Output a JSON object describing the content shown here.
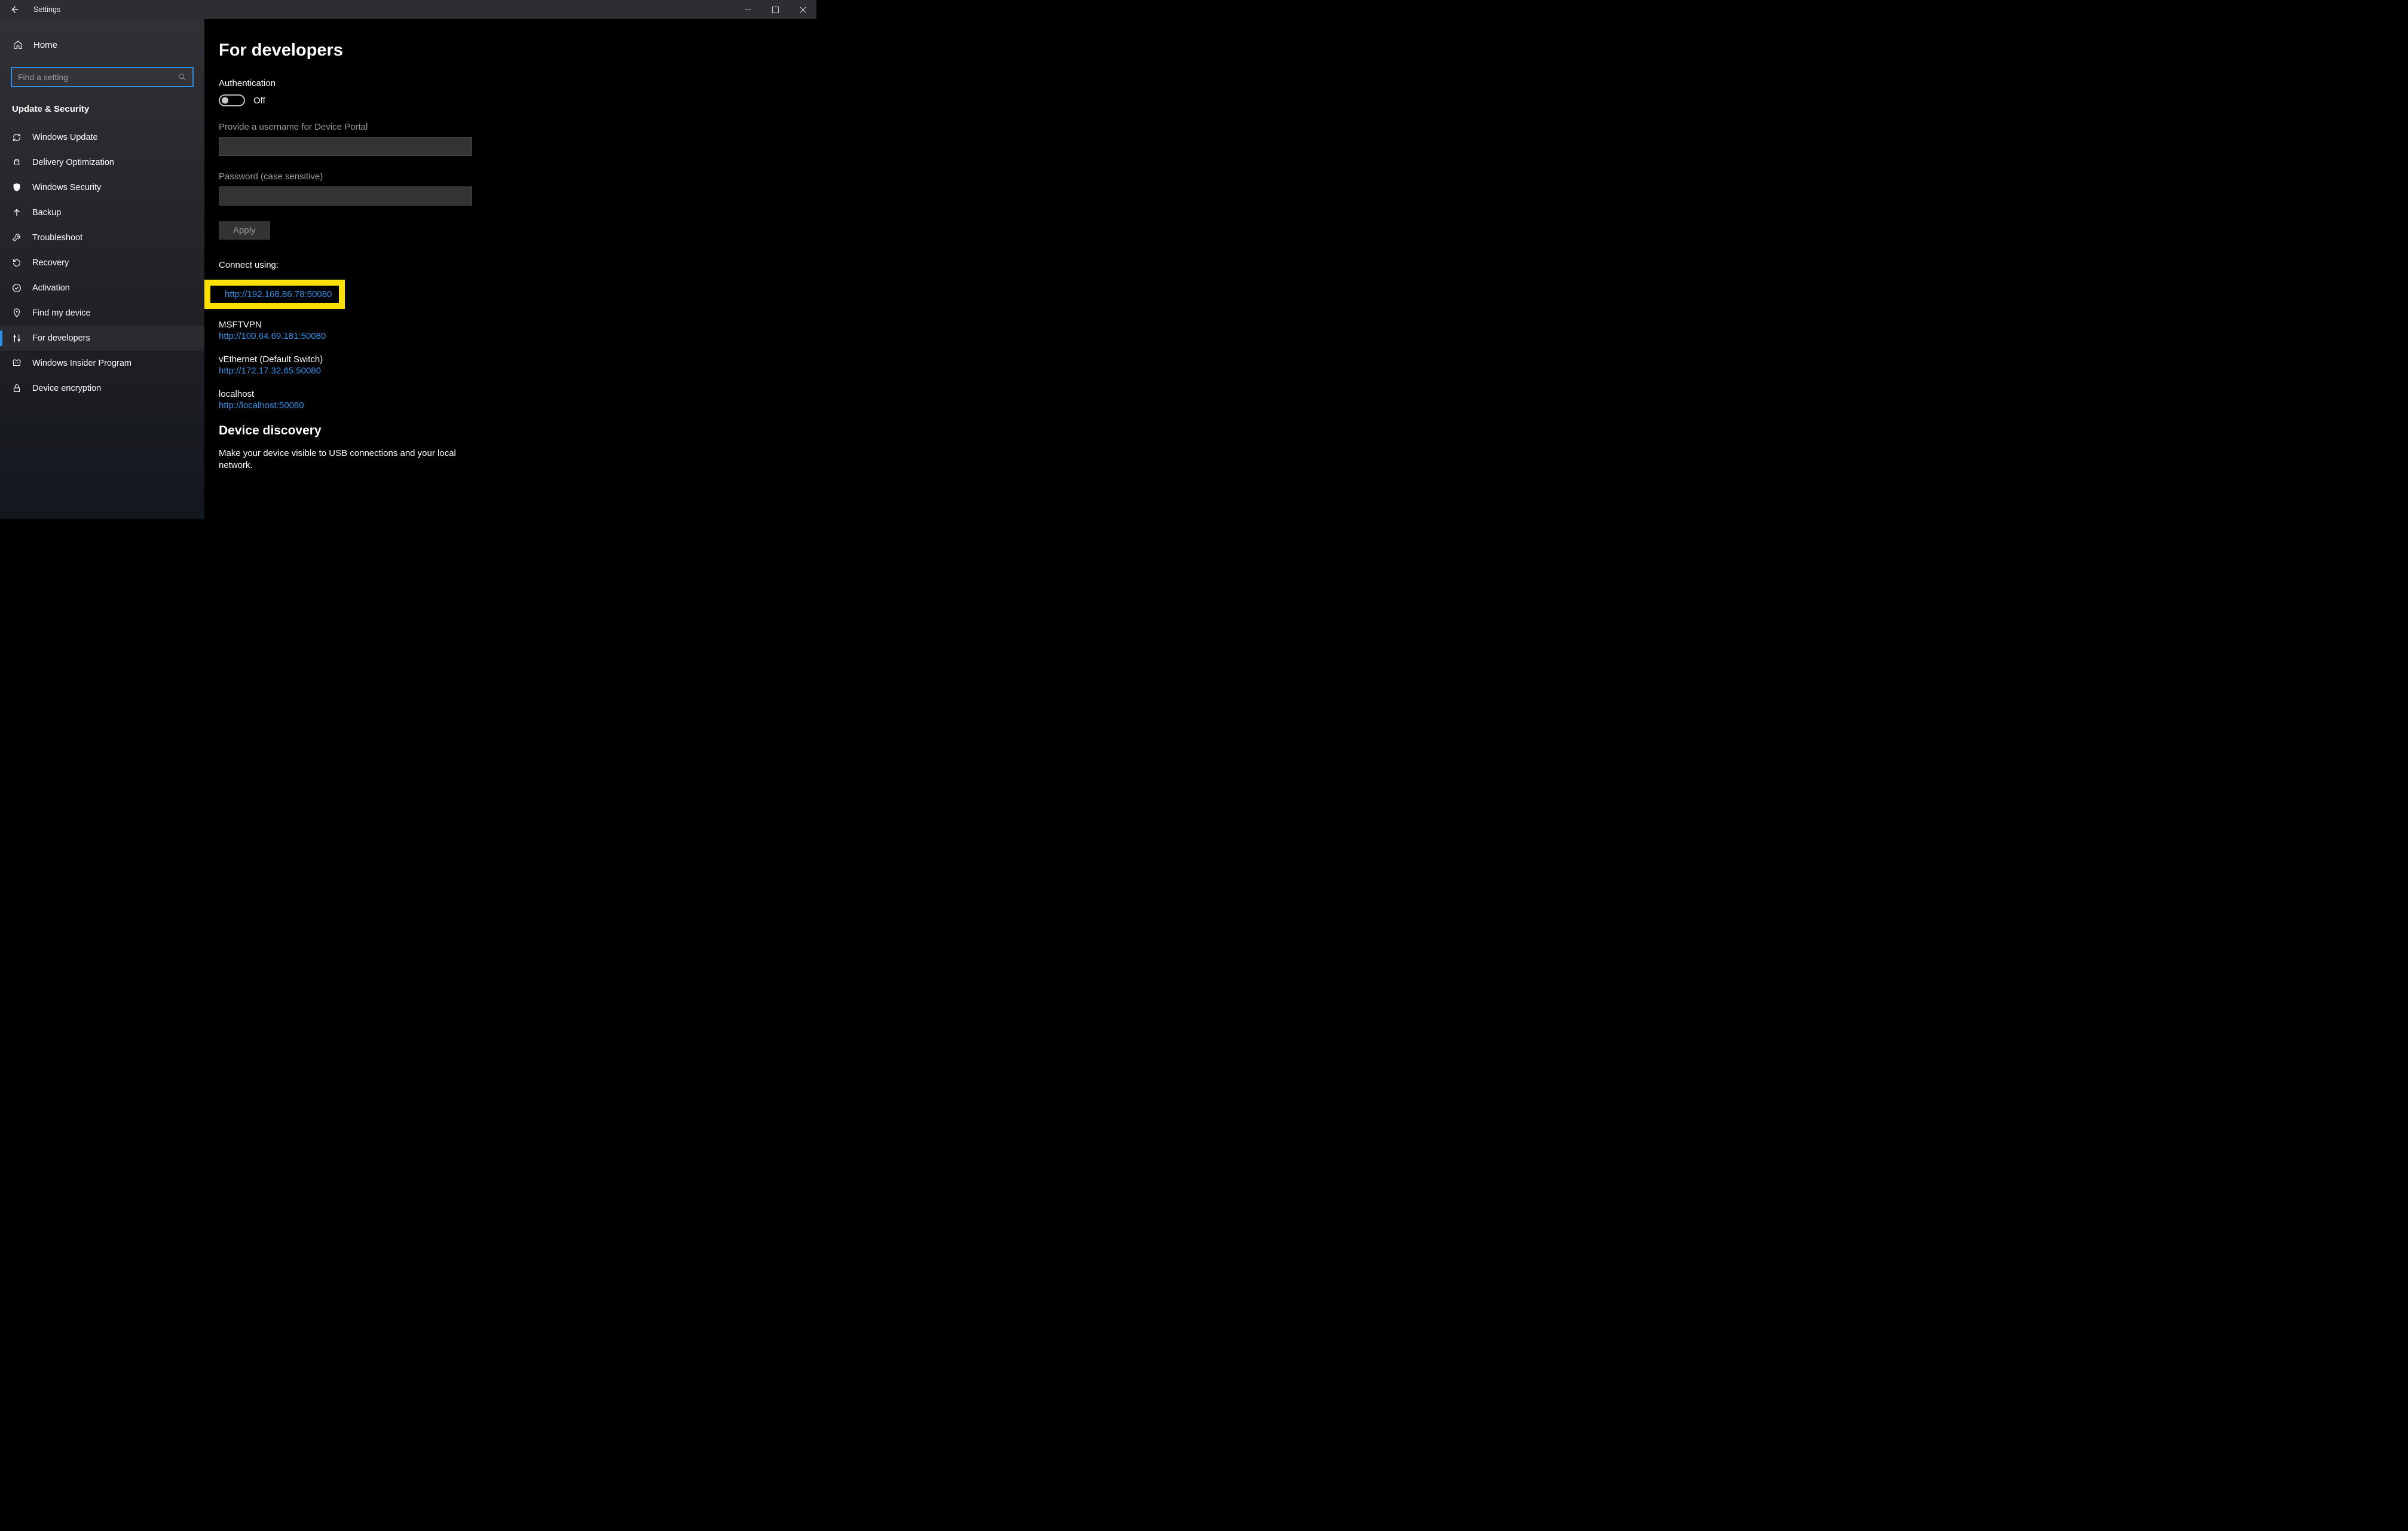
{
  "window": {
    "title": "Settings"
  },
  "sidebar": {
    "home_label": "Home",
    "search_placeholder": "Find a setting",
    "category_label": "Update & Security",
    "items": [
      {
        "label": "Windows Update"
      },
      {
        "label": "Delivery Optimization"
      },
      {
        "label": "Windows Security"
      },
      {
        "label": "Backup"
      },
      {
        "label": "Troubleshoot"
      },
      {
        "label": "Recovery"
      },
      {
        "label": "Activation"
      },
      {
        "label": "Find my device"
      },
      {
        "label": "For developers"
      },
      {
        "label": "Windows Insider Program"
      },
      {
        "label": "Device encryption"
      }
    ]
  },
  "main": {
    "page_title": "For developers",
    "auth": {
      "heading": "Authentication",
      "toggle_state_label": "Off",
      "username_label": "Provide a username for Device Portal",
      "password_label": "Password (case sensitive)",
      "apply_label": "Apply"
    },
    "connect": {
      "heading": "Connect using:",
      "items": [
        {
          "name": "",
          "url": "http://192.168.86.78:50080",
          "highlighted": true
        },
        {
          "name": "MSFTVPN",
          "url": "http://100.64.69.181:50080"
        },
        {
          "name": "vEthernet (Default Switch)",
          "url": "http://172.17.32.65:50080"
        },
        {
          "name": "localhost",
          "url": "http://localhost:50080"
        }
      ]
    },
    "discovery": {
      "heading": "Device discovery",
      "desc": "Make your device visible to USB connections and your local network."
    }
  }
}
